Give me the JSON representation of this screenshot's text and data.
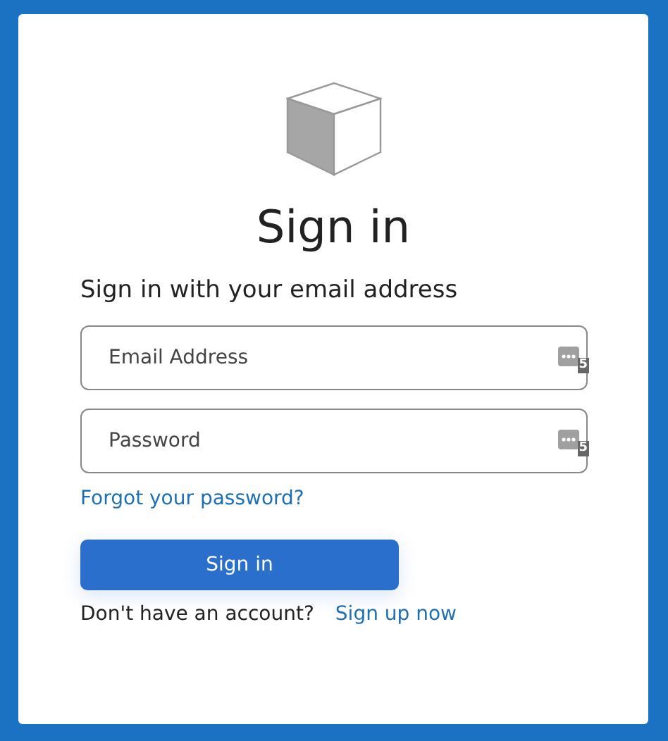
{
  "title": "Sign in",
  "subtitle": "Sign in with your email address",
  "fields": [
    {
      "placeholder": "Email Address",
      "badge": "5"
    },
    {
      "placeholder": "Password",
      "badge": "5"
    }
  ],
  "forgot_link": "Forgot your password?",
  "submit_button": "Sign in",
  "footer": {
    "text": "Don't have an account?",
    "link": "Sign up now"
  }
}
